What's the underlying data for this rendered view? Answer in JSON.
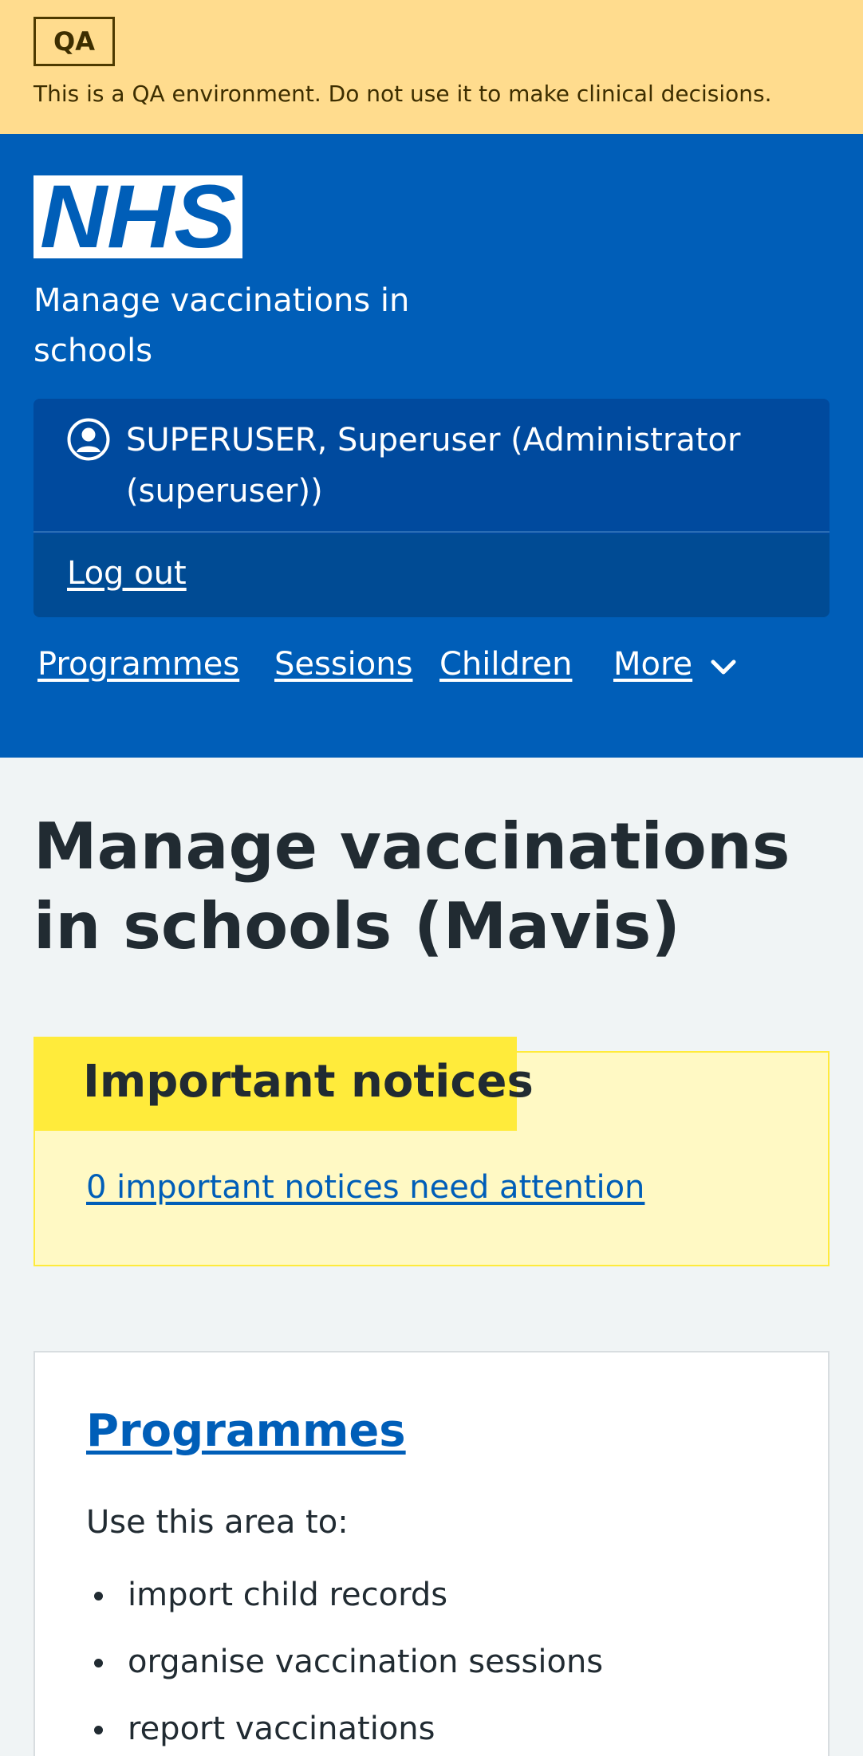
{
  "qa_banner": {
    "tag": "QA",
    "message": "This is a QA environment. Do not use it to make clinical decisions."
  },
  "header": {
    "logo_text": "NHS",
    "service_name": "Manage vaccinations in schools",
    "account": {
      "user_label": "SUPERUSER, Superuser (Administrator (superuser))",
      "user_icon": "user-circle-icon",
      "logout_label": "Log out"
    },
    "nav": {
      "items": [
        "Programmes",
        "Sessions",
        "Children"
      ],
      "more_label": "More",
      "more_icon": "chevron-down-icon"
    }
  },
  "main": {
    "title": "Manage vaccinations in schools (Mavis)",
    "notices": {
      "heading": "Important notices",
      "link": "0 important notices need attention"
    },
    "cards": [
      {
        "title": "Programmes",
        "intro": "Use this area to:",
        "items": [
          "import child records",
          "organise vaccination sessions",
          "report vaccinations"
        ]
      }
    ]
  },
  "colors": {
    "nhs_blue": "#005eb8",
    "qa_banner": "#ffdc8e",
    "notice_yellow": "#ffeb3b",
    "notice_bg": "#fff9c4",
    "page_bg": "#f0f4f5",
    "text": "#212b32"
  }
}
